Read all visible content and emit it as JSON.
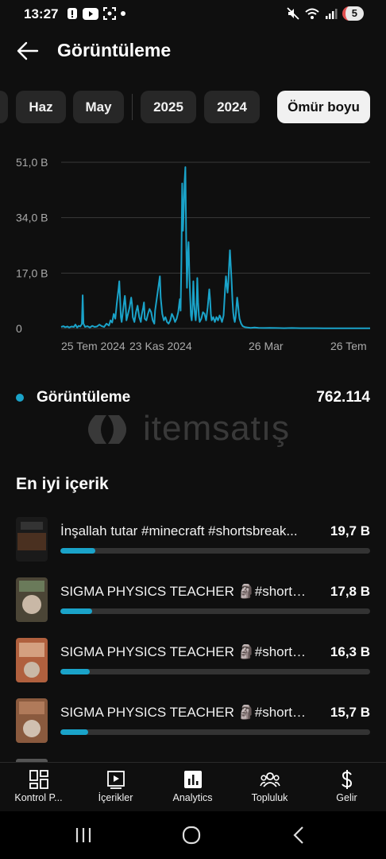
{
  "status_bar": {
    "time": "13:27",
    "battery": "5"
  },
  "header": {
    "title": "Görüntüleme"
  },
  "filters": [
    {
      "label": ""
    },
    {
      "label": "Haz"
    },
    {
      "label": "May"
    },
    {
      "label": "2025"
    },
    {
      "label": "2024"
    },
    {
      "label": "Ömür boyu",
      "active": true
    }
  ],
  "chart_data": {
    "type": "line",
    "title": "",
    "series_color": "#1aa3c9",
    "y_ticks": [
      "51,0 B",
      "34,0 B",
      "17,0 B",
      "0"
    ],
    "y_tick_values": [
      51000,
      34000,
      17000,
      0
    ],
    "x_ticks": [
      "25 Tem 2024",
      "23 Kas 2024",
      "26 Mar",
      "26 Tem"
    ],
    "ylim": [
      0,
      51000
    ],
    "grid": true,
    "series": [
      {
        "name": "Görüntüleme",
        "points": [
          [
            0,
            500
          ],
          [
            3,
            700
          ],
          [
            5,
            400
          ],
          [
            8,
            600
          ],
          [
            10,
            300
          ],
          [
            13,
            600
          ],
          [
            16,
            500
          ],
          [
            18,
            1200
          ],
          [
            20,
            300
          ],
          [
            22,
            800
          ],
          [
            24,
            600
          ],
          [
            26,
            1400
          ],
          [
            27,
            10200
          ],
          [
            28,
            1500
          ],
          [
            30,
            500
          ],
          [
            33,
            700
          ],
          [
            36,
            300
          ],
          [
            39,
            800
          ],
          [
            42,
            500
          ],
          [
            45,
            600
          ],
          [
            48,
            1200
          ],
          [
            51,
            700
          ],
          [
            54,
            500
          ],
          [
            57,
            1500
          ],
          [
            60,
            900
          ],
          [
            62,
            2500
          ],
          [
            64,
            1800
          ],
          [
            66,
            4500
          ],
          [
            68,
            3000
          ],
          [
            70,
            8000
          ],
          [
            72,
            12000
          ],
          [
            73,
            14500
          ],
          [
            74,
            9000
          ],
          [
            75,
            3500
          ],
          [
            76,
            2000
          ],
          [
            78,
            6000
          ],
          [
            80,
            10000
          ],
          [
            81,
            7000
          ],
          [
            82,
            2500
          ],
          [
            84,
            4500
          ],
          [
            86,
            6500
          ],
          [
            88,
            9500
          ],
          [
            89,
            7500
          ],
          [
            90,
            3500
          ],
          [
            92,
            2000
          ],
          [
            94,
            5000
          ],
          [
            96,
            7000
          ],
          [
            98,
            3500
          ],
          [
            100,
            2000
          ],
          [
            101,
            4000
          ],
          [
            103,
            6500
          ],
          [
            104,
            8000
          ],
          [
            105,
            3000
          ],
          [
            107,
            2500
          ],
          [
            109,
            4500
          ],
          [
            111,
            6000
          ],
          [
            113,
            5000
          ],
          [
            115,
            2500
          ],
          [
            117,
            1500
          ],
          [
            118,
            5500
          ],
          [
            120,
            9000
          ],
          [
            122,
            12500
          ],
          [
            124,
            16000
          ],
          [
            125,
            9500
          ],
          [
            127,
            4500
          ],
          [
            129,
            2500
          ],
          [
            131,
            3500
          ],
          [
            133,
            2000
          ],
          [
            135,
            1500
          ],
          [
            137,
            2500
          ],
          [
            139,
            4500
          ],
          [
            141,
            3500
          ],
          [
            143,
            2000
          ],
          [
            145,
            3000
          ],
          [
            147,
            5000
          ],
          [
            148,
            7000
          ],
          [
            149,
            9000
          ],
          [
            150,
            5500
          ],
          [
            151,
            20500
          ],
          [
            152,
            44500
          ],
          [
            153,
            30000
          ],
          [
            154,
            36500
          ],
          [
            155,
            45000
          ],
          [
            156,
            49500
          ],
          [
            157,
            28000
          ],
          [
            158,
            12500
          ],
          [
            159,
            22000
          ],
          [
            160,
            26500
          ],
          [
            161,
            17000
          ],
          [
            162,
            10000
          ],
          [
            163,
            4000
          ],
          [
            164,
            2500
          ],
          [
            165,
            6000
          ],
          [
            166,
            14500
          ],
          [
            167,
            8000
          ],
          [
            168,
            4500
          ],
          [
            169,
            2500
          ],
          [
            170,
            6000
          ],
          [
            171,
            15500
          ],
          [
            172,
            8000
          ],
          [
            173,
            4000
          ],
          [
            174,
            2000
          ],
          [
            176,
            3000
          ],
          [
            178,
            5000
          ],
          [
            180,
            4500
          ],
          [
            182,
            2500
          ],
          [
            184,
            6500
          ],
          [
            186,
            12000
          ],
          [
            187,
            9000
          ],
          [
            188,
            4500
          ],
          [
            189,
            2500
          ],
          [
            191,
            3500
          ],
          [
            193,
            2000
          ],
          [
            195,
            3500
          ],
          [
            197,
            2500
          ],
          [
            199,
            4000
          ],
          [
            200,
            3500
          ],
          [
            202,
            2000
          ],
          [
            204,
            4000
          ],
          [
            206,
            12500
          ],
          [
            207,
            16000
          ],
          [
            208,
            13500
          ],
          [
            209,
            11000
          ],
          [
            210,
            14000
          ],
          [
            211,
            19500
          ],
          [
            212,
            24000
          ],
          [
            213,
            19500
          ],
          [
            214,
            14500
          ],
          [
            215,
            9000
          ],
          [
            216,
            5000
          ],
          [
            217,
            3000
          ],
          [
            218,
            2000
          ],
          [
            219,
            3500
          ],
          [
            220,
            6500
          ],
          [
            221,
            9500
          ],
          [
            222,
            7500
          ],
          [
            223,
            5000
          ],
          [
            224,
            3000
          ],
          [
            226,
            1500
          ],
          [
            228,
            700
          ],
          [
            231,
            400
          ],
          [
            234,
            300
          ],
          [
            238,
            200
          ],
          [
            243,
            300
          ],
          [
            248,
            200
          ],
          [
            255,
            150
          ],
          [
            262,
            200
          ],
          [
            270,
            150
          ],
          [
            280,
            100
          ],
          [
            290,
            150
          ],
          [
            300,
            100
          ],
          [
            310,
            100
          ],
          [
            320,
            100
          ],
          [
            330,
            80
          ],
          [
            340,
            80
          ],
          [
            350,
            60
          ],
          [
            360,
            60
          ],
          [
            370,
            50
          ],
          [
            380,
            50
          ],
          [
            388,
            50
          ]
        ]
      }
    ]
  },
  "legend": {
    "label": "Görüntüleme",
    "value": "762.114",
    "color": "#1aa3c9"
  },
  "watermark": {
    "text": "itemsatış"
  },
  "top_content": {
    "title": "En iyi içerik",
    "items": [
      {
        "title": "İnşallah tutar #minecraft #shortsbreak...",
        "value": "19,7 B",
        "fraction": 0.113,
        "thumb_color": "#3a2a22"
      },
      {
        "title": "SIGMA PHYSICS TEACHER 🗿#shorts ...",
        "value": "17,8 B",
        "fraction": 0.102,
        "thumb_color": "#5b5140"
      },
      {
        "title": "SIGMA PHYSICS TEACHER 🗿#shorts ...",
        "value": "16,3 B",
        "fraction": 0.094,
        "thumb_color": "#a8583a"
      },
      {
        "title": "SIGMA PHYSICS TEACHER 🗿#shorts ...",
        "value": "15,7 B",
        "fraction": 0.09,
        "thumb_color": "#8a5a3e"
      }
    ]
  },
  "bottom_nav": [
    {
      "label": "Kontrol P...",
      "icon": "dashboard-icon"
    },
    {
      "label": "İçerikler",
      "icon": "content-icon"
    },
    {
      "label": "Analytics",
      "icon": "analytics-icon",
      "active": true
    },
    {
      "label": "Topluluk",
      "icon": "community-icon"
    },
    {
      "label": "Gelir",
      "icon": "earn-icon"
    }
  ]
}
